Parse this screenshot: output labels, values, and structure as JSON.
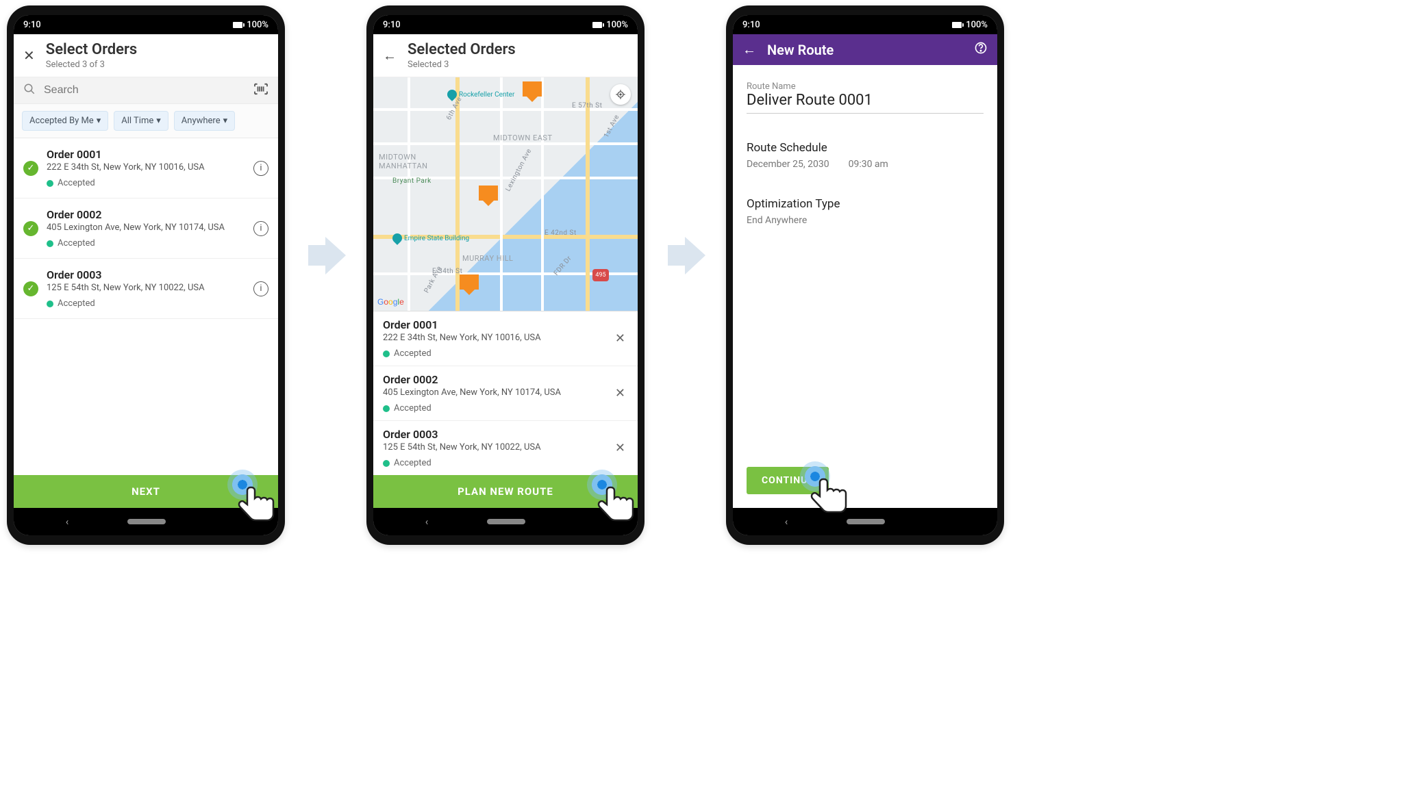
{
  "status": {
    "time": "9:10",
    "battery": "100%"
  },
  "screen1": {
    "title": "Select Orders",
    "subtitle": "Selected 3 of 3",
    "search_placeholder": "Search",
    "filter1": "Accepted By Me",
    "filter2": "All Time",
    "filter3": "Anywhere",
    "orders": [
      {
        "title": "Order 0001",
        "addr": "222 E 34th St, New York, NY 10016, USA",
        "status": "Accepted"
      },
      {
        "title": "Order 0002",
        "addr": "405 Lexington Ave, New York, NY 10174, USA",
        "status": "Accepted"
      },
      {
        "title": "Order 0003",
        "addr": "125 E 54th St, New York, NY 10022, USA",
        "status": "Accepted"
      }
    ],
    "button": "NEXT"
  },
  "screen2": {
    "title": "Selected Orders",
    "subtitle": "Selected 3",
    "map": {
      "poi1": "Rockefeller Center",
      "poi2": "Empire State Building",
      "label_midtown": "MIDTOWN EAST",
      "label_manhattan": "MIDTOWN MANHATTAN",
      "label_murray": "MURRAY HILL",
      "label_bryant": "Bryant Park",
      "st_57": "E 57th St",
      "st_42": "E 42nd St",
      "st_34": "E 34th St",
      "ave_1": "1st Ave",
      "ave_6": "6th Ave",
      "ave_lex": "Lexington Ave",
      "ave_park": "Park Ave",
      "fdr": "FDR Dr",
      "highway": "495"
    },
    "orders": [
      {
        "title": "Order 0001",
        "addr": "222 E 34th St, New York, NY 10016, USA",
        "status": "Accepted"
      },
      {
        "title": "Order 0002",
        "addr": "405 Lexington Ave, New York, NY 10174, USA",
        "status": "Accepted"
      },
      {
        "title": "Order 0003",
        "addr": "125 E 54th St, New York, NY 10022, USA",
        "status": "Accepted"
      }
    ],
    "button": "PLAN NEW ROUTE"
  },
  "screen3": {
    "title": "New Route",
    "route_name_label": "Route Name",
    "route_name_value": "Deliver Route 0001",
    "schedule_label": "Route Schedule",
    "schedule_date": "December 25, 2030",
    "schedule_time": "09:30 am",
    "opt_label": "Optimization Type",
    "opt_value": "End Anywhere",
    "button": "CONTINUE"
  }
}
